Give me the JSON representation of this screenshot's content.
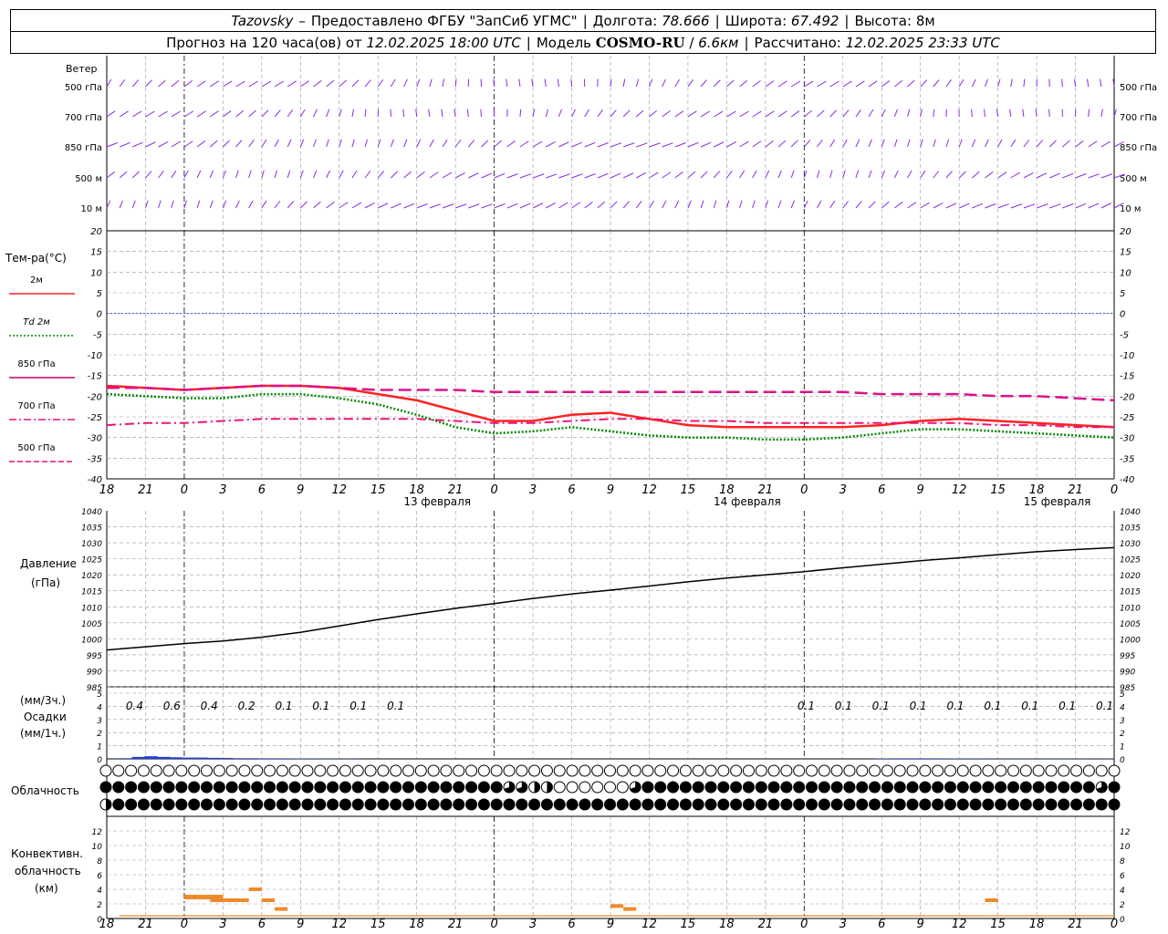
{
  "header": {
    "station": "Tazovsky",
    "provider": "Предоставлено ФГБУ \"ЗапСиб УГМС\"",
    "lon_label": "Долгота:",
    "lon_value": "78.666",
    "lat_label": "Широта:",
    "lat_value": "67.492",
    "alt_label": "Высота:",
    "alt_value": "8м",
    "forecast_prefix": "Прогноз на 120 часа(ов) от",
    "forecast_start": "12.02.2025 18:00 UTC",
    "model_label": "Модель",
    "model_name": "COSMO-RU",
    "model_res": "6.6км",
    "computed_label": "Рассчитано:",
    "computed_time": "12.02.2025 23:33 UTC"
  },
  "labels": {
    "wind_title": "Ветер",
    "wind_levels": [
      "500 гПа",
      "700 гПа",
      "850 гПа",
      "500 м",
      "10 м"
    ],
    "temp_title": "Тем-ра(°C)",
    "legend": [
      {
        "name": "2м",
        "color": "#ff2222",
        "style": "solid"
      },
      {
        "name": "Td 2м",
        "color": "#008800",
        "style": "dotted"
      },
      {
        "name": "850 гПа",
        "color": "#cc0077",
        "style": "solid"
      },
      {
        "name": "700 гПа",
        "color": "#ee1177",
        "style": "dashdot"
      },
      {
        "name": "500 гПа",
        "color": "#ee1177",
        "style": "dash"
      }
    ],
    "pressure_title": "Давление",
    "pressure_unit": "(гПа)",
    "precip_unit3": "(мм/3ч.)",
    "precip_title": "Осадки",
    "precip_unit1": "(мм/1ч.)",
    "cloud_title": "Облачность",
    "conv_title1": "Конвективн.",
    "conv_title2": "облачность",
    "conv_unit": "(км)",
    "day_labels": [
      "13 февраля",
      "14 февраля",
      "15 февраля"
    ],
    "hour_ticks": [
      "18",
      "21",
      "0",
      "3",
      "6",
      "9",
      "12",
      "15",
      "18",
      "21",
      "0",
      "3",
      "6",
      "9",
      "12",
      "15",
      "18",
      "21",
      "0",
      "3",
      "6",
      "9",
      "12",
      "15",
      "18",
      "21",
      "0"
    ]
  },
  "chart_data": [
    {
      "type": "line",
      "name": "temperature",
      "x_hours": [
        0,
        3,
        6,
        9,
        12,
        15,
        18,
        21,
        24,
        27,
        30,
        33,
        36,
        39,
        42,
        45,
        48,
        51,
        54,
        57,
        60,
        63,
        66,
        69,
        72,
        75,
        78
      ],
      "ylim": [
        -40,
        20
      ],
      "yticks": [
        20,
        15,
        10,
        5,
        0,
        -5,
        -10,
        -15,
        -20,
        -25,
        -30,
        -35,
        -40
      ],
      "series": [
        {
          "name": "2м",
          "values": [
            -17.5,
            -18.0,
            -18.5,
            -18.0,
            -17.5,
            -17.5,
            -18.0,
            -19.5,
            -21.0,
            -23.5,
            -26.0,
            -26.0,
            -24.5,
            -24.0,
            -25.5,
            -27.0,
            -27.5,
            -27.5,
            -27.5,
            -27.5,
            -27.0,
            -26.0,
            -25.5,
            -26.0,
            -26.5,
            -27.0,
            -27.5
          ]
        },
        {
          "name": "Td 2м",
          "values": [
            -19.5,
            -20.0,
            -20.5,
            -20.5,
            -19.5,
            -19.5,
            -20.5,
            -22.0,
            -24.5,
            -27.5,
            -29.0,
            -28.5,
            -27.5,
            -28.5,
            -29.5,
            -30.0,
            -30.0,
            -30.5,
            -30.5,
            -30.0,
            -29.0,
            -28.0,
            -28.0,
            -28.5,
            -29.0,
            -29.5,
            -30.0
          ]
        },
        {
          "name": "850 гПа",
          "values": [
            -18.0,
            -18.0,
            -18.5,
            -18.0,
            -17.5,
            -17.5,
            -18.0,
            -18.5,
            -18.5,
            -18.5,
            -19.0,
            -19.0,
            -19.0,
            -19.0,
            -19.0,
            -19.0,
            -19.0,
            -19.0,
            -19.0,
            -19.0,
            -19.5,
            -19.5,
            -19.5,
            -20.0,
            -20.0,
            -20.5,
            -21.0
          ]
        },
        {
          "name": "700 гПа",
          "values": [
            -27.0,
            -26.5,
            -26.5,
            -26.0,
            -25.5,
            -25.5,
            -25.5,
            -25.5,
            -25.5,
            -26.0,
            -26.5,
            -26.5,
            -26.0,
            -25.5,
            -25.5,
            -26.0,
            -26.0,
            -26.5,
            -26.5,
            -26.5,
            -26.5,
            -26.5,
            -26.5,
            -27.0,
            -27.0,
            -27.5,
            -27.5
          ]
        },
        {
          "name": "500 гПа",
          "values": [
            -18.0,
            -18.0,
            -18.5,
            -18.0,
            -17.5,
            -17.5,
            -18.0,
            -18.5,
            -18.5,
            -18.5,
            -19.0,
            -19.0,
            -19.0,
            -19.0,
            -19.0,
            -19.0,
            -19.0,
            -19.0,
            -19.0,
            -19.0,
            -19.5,
            -19.5,
            -19.5,
            -20.0,
            -20.0,
            -20.5,
            -21.0
          ]
        }
      ]
    },
    {
      "type": "line",
      "name": "pressure",
      "x_hours": [
        0,
        3,
        6,
        9,
        12,
        15,
        18,
        21,
        24,
        27,
        30,
        33,
        36,
        39,
        42,
        45,
        48,
        51,
        54,
        57,
        60,
        63,
        66,
        69,
        72,
        75,
        78
      ],
      "ylim": [
        985,
        1040
      ],
      "yticks": [
        1040,
        1035,
        1030,
        1025,
        1020,
        1015,
        1010,
        1005,
        1000,
        995,
        990,
        985
      ],
      "series": [
        {
          "name": "Давление",
          "values": [
            996.5,
            997.5,
            998.5,
            999.3,
            1000.5,
            1002,
            1004,
            1006,
            1007.8,
            1009.5,
            1011,
            1012.6,
            1014,
            1015.2,
            1016.5,
            1017.8,
            1019,
            1020,
            1021,
            1022.2,
            1023.3,
            1024.4,
            1025.3,
            1026.3,
            1027.2,
            1027.9,
            1028.5
          ]
        }
      ]
    },
    {
      "type": "bar",
      "name": "precipitation",
      "ylim": [
        0,
        5
      ],
      "yticks": [
        5,
        4,
        3,
        2,
        1,
        0
      ],
      "hourly_values": [
        0.0,
        0.05,
        0.15,
        0.2,
        0.15,
        0.12,
        0.1,
        0.1,
        0.08,
        0.07,
        0.05,
        0.05,
        0.04,
        0.04,
        0.03,
        0.03,
        0.03,
        0.02,
        0.02,
        0.02,
        0.0,
        0.0,
        0.0,
        0.0,
        0.0,
        0.0,
        0.0,
        0.0,
        0.0,
        0.0,
        0.0,
        0.0,
        0.0,
        0.0,
        0.0,
        0.0,
        0.0,
        0.0,
        0.0,
        0.0,
        0.0,
        0.0,
        0.0,
        0.0,
        0.0,
        0.0,
        0.0,
        0.0,
        0.0,
        0.0,
        0.0,
        0.0,
        0.0,
        0.0,
        0.0,
        0.0,
        0.0,
        0.0,
        0.0,
        0.0,
        0.0,
        0.03,
        0.04,
        0.04,
        0.04,
        0.04,
        0.03,
        0.03,
        0.03,
        0.03,
        0.02,
        0.02,
        0.02,
        0.02,
        0.02,
        0.02,
        0.02,
        0.02,
        0.01,
        0.02
      ],
      "three_hour_labels": [
        {
          "hour": 1.5,
          "value": "0.4"
        },
        {
          "hour": 4.5,
          "value": "0.6"
        },
        {
          "hour": 7.5,
          "value": "0.4"
        },
        {
          "hour": 10.5,
          "value": "0.2"
        },
        {
          "hour": 13.5,
          "value": "0.1"
        },
        {
          "hour": 16.5,
          "value": "0.1"
        },
        {
          "hour": 19.5,
          "value": "0.1"
        },
        {
          "hour": 22.5,
          "value": "0.1"
        },
        {
          "hour": 55.5,
          "value": "0.1"
        },
        {
          "hour": 58.5,
          "value": "0.1"
        },
        {
          "hour": 61.5,
          "value": "0.1"
        },
        {
          "hour": 64.5,
          "value": "0.1"
        },
        {
          "hour": 67.5,
          "value": "0.1"
        },
        {
          "hour": 70.5,
          "value": "0.1"
        },
        {
          "hour": 73.5,
          "value": "0.1"
        },
        {
          "hour": 76.5,
          "value": "0.1"
        },
        {
          "hour": 79.5,
          "value": "0.1"
        }
      ]
    },
    {
      "type": "bar",
      "name": "convective_cloud",
      "ylim": [
        0,
        14
      ],
      "yticks": [
        12,
        10,
        8,
        6,
        4,
        2,
        0
      ],
      "segments": [
        {
          "from": 6,
          "to": 9,
          "bottom": 0,
          "top": 3
        },
        {
          "from": 8,
          "to": 11,
          "bottom": 2.5,
          "top": 2.5
        },
        {
          "from": 11,
          "to": 12,
          "bottom": 4,
          "top": 4
        },
        {
          "from": 12,
          "to": 13,
          "bottom": 2.5,
          "top": 2.5
        },
        {
          "from": 13,
          "to": 14,
          "bottom": 1.3,
          "top": 1.3
        },
        {
          "from": 39,
          "to": 40,
          "bottom": 1.7,
          "top": 1.7
        },
        {
          "from": 40,
          "to": 41,
          "bottom": 1.3,
          "top": 1.3
        },
        {
          "from": 68,
          "to": 69,
          "bottom": 2.5,
          "top": 2.5
        }
      ]
    },
    {
      "type": "table",
      "name": "cloudiness",
      "rows": [
        {
          "level": "upper",
          "cover": [
            0,
            0,
            0,
            0,
            0,
            0,
            0,
            0,
            0,
            0,
            0,
            0,
            0,
            0,
            0,
            0,
            0,
            0,
            0,
            0,
            0,
            0,
            0,
            0,
            0,
            0,
            0,
            0,
            0,
            0,
            0,
            0,
            0,
            0,
            0,
            0,
            0,
            0,
            0,
            0,
            0,
            0,
            0,
            0,
            0,
            0,
            0,
            0,
            0,
            0,
            0,
            0,
            0,
            0,
            0,
            0,
            0,
            0,
            0,
            0,
            0,
            0,
            0,
            0,
            0,
            0,
            0,
            0,
            0,
            0,
            0,
            0,
            0,
            0,
            0,
            0,
            0,
            0,
            0,
            0,
            0
          ]
        },
        {
          "level": "middle",
          "cover": [
            1,
            1,
            1,
            1,
            1,
            1,
            1,
            1,
            1,
            1,
            1,
            1,
            1,
            1,
            1,
            1,
            1,
            1,
            1,
            1,
            1,
            1,
            1,
            1,
            1,
            1,
            1,
            1,
            1,
            1,
            1,
            1,
            0.7,
            0.7,
            0.5,
            0.5,
            0,
            0,
            0,
            0,
            0,
            0,
            0.7,
            1,
            1,
            1,
            1,
            1,
            1,
            1,
            1,
            1,
            1,
            1,
            1,
            1,
            1,
            1,
            1,
            1,
            1,
            1,
            1,
            1,
            1,
            1,
            1,
            1,
            1,
            1,
            1,
            1,
            1,
            1,
            1,
            1,
            1,
            1,
            1,
            0.7,
            1
          ]
        },
        {
          "level": "lower",
          "cover": [
            0.5,
            1,
            1,
            1,
            1,
            1,
            1,
            1,
            1,
            1,
            1,
            1,
            1,
            1,
            1,
            1,
            1,
            1,
            1,
            1,
            1,
            1,
            1,
            1,
            1,
            1,
            1,
            1,
            1,
            1,
            1,
            1,
            1,
            1,
            1,
            1,
            1,
            1,
            1,
            1,
            1,
            1,
            1,
            1,
            1,
            1,
            1,
            1,
            1,
            1,
            1,
            1,
            1,
            1,
            1,
            1,
            1,
            1,
            1,
            1,
            1,
            1,
            1,
            1,
            1,
            1,
            1,
            1,
            1,
            1,
            1,
            1,
            1,
            1,
            1,
            1,
            1,
            1,
            1,
            1,
            1
          ]
        }
      ]
    }
  ],
  "colors": {
    "wind": "#8a2be2",
    "grid": "#999999",
    "pressure": "#000000",
    "precip": "#1f3fd6",
    "convective": "#ee8a2a",
    "zero_line": "#3355ff"
  }
}
